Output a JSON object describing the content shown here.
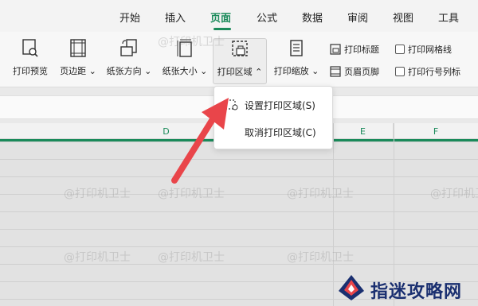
{
  "tabs": [
    {
      "label": "开始",
      "active": false
    },
    {
      "label": "插入",
      "active": false
    },
    {
      "label": "页面",
      "active": true
    },
    {
      "label": "公式",
      "active": false
    },
    {
      "label": "数据",
      "active": false
    },
    {
      "label": "审阅",
      "active": false
    },
    {
      "label": "视图",
      "active": false
    },
    {
      "label": "工具",
      "active": false
    }
  ],
  "ribbon": {
    "print_preview": "打印预览",
    "margins": "页边距",
    "orientation": "纸张方向",
    "paper_size": "纸张大小",
    "print_area": "打印区域",
    "print_scale": "打印缩放",
    "print_titles": "打印标题",
    "header_footer": "页眉页脚",
    "print_gridlines": "打印网格线",
    "print_row_col": "打印行号列标"
  },
  "columns": {
    "d": "D",
    "e": "E",
    "f": "F"
  },
  "dropdown": {
    "set_area": "设置打印区域(S)",
    "clear_area": "取消打印区域(C)"
  },
  "watermark": "@打印机卫士",
  "logo_text": "指迷攻略网",
  "colors": {
    "accent": "#1a8a5a",
    "arrow": "#e9454a",
    "logo": "#1a2f70"
  }
}
